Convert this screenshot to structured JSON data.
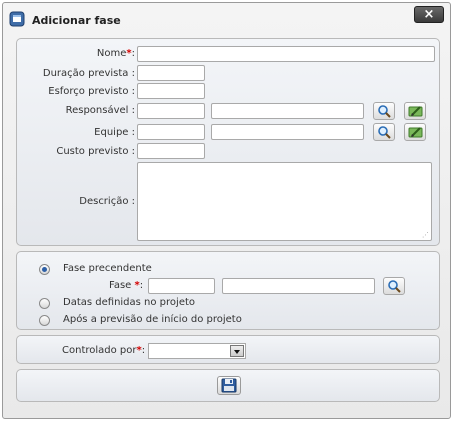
{
  "dialog": {
    "title": "Adicionar fase",
    "close_label": "×",
    "app_icon": "window-icon"
  },
  "form": {
    "nome_label": "Nome",
    "nome_value": "",
    "duracao_label": "Duração prevista :",
    "esforco_label": "Esforço previsto :",
    "responsavel_label": "Responsável :",
    "equipe_label": "Equipe :",
    "custo_label": "Custo previsto :",
    "descricao_label": "Descrição :",
    "required_mark": "*",
    "colon": ":",
    "search_icon": "magnifier-icon",
    "edit_icon": "pencil-icon",
    "required_color": "#d40000"
  },
  "schedule": {
    "option_fase_label": "Fase precendente",
    "fase_label": "Fase",
    "option_datas_label": "Datas definidas no projeto",
    "option_apos_label": "Após a previsão de início do projeto",
    "selected": "fase"
  },
  "control": {
    "controlado_label": "Controlado por",
    "selected_value": ""
  },
  "footer": {
    "save_icon": "floppy-disk-icon"
  }
}
